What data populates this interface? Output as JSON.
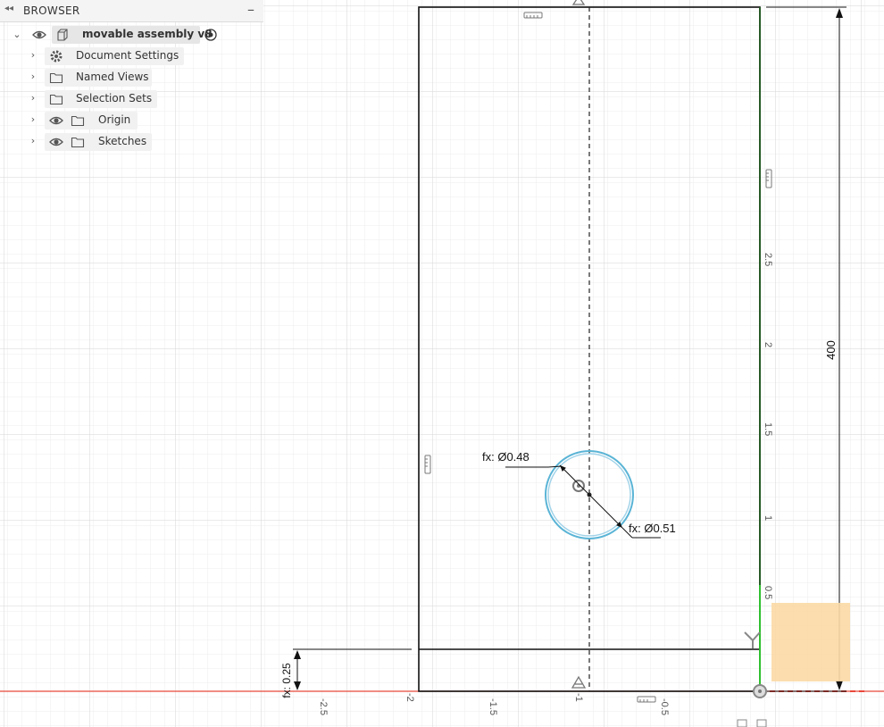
{
  "browser": {
    "title": "BROWSER",
    "collapse_glyph": "◂◂",
    "minus_glyph": "–",
    "items": [
      {
        "label": "movable assembly v8",
        "icon": "component-icon",
        "has_eye": true,
        "has_target": true
      },
      {
        "label": "Document Settings",
        "icon": "gear-icon",
        "has_eye": false
      },
      {
        "label": "Named Views",
        "icon": "folder-icon",
        "has_eye": false
      },
      {
        "label": "Selection Sets",
        "icon": "folder-icon",
        "has_eye": false
      },
      {
        "label": "Origin",
        "icon": "folder-icon",
        "has_eye": true
      },
      {
        "label": "Sketches",
        "icon": "folder-icon",
        "has_eye": true
      }
    ]
  },
  "sketch": {
    "dim_diameter_inner": "fx: Ø0.48",
    "dim_diameter_outer": "fx: Ø0.51",
    "dim_height": "400",
    "dim_bottom": "fx: 0.25",
    "ruler_vertical": [
      "2.5",
      "2",
      "1.5",
      "1",
      "0.5"
    ],
    "ruler_horizontal": [
      "-2.5",
      "-2",
      "-1.5",
      "-1",
      "-0.5"
    ],
    "colors": {
      "grid": "#e3e3e3",
      "line": "#111111",
      "circle": "#5ab4d6",
      "axis_x": "#e8473a",
      "axis_y": "#2fc02f",
      "highlight": "#fbd9a5"
    }
  }
}
